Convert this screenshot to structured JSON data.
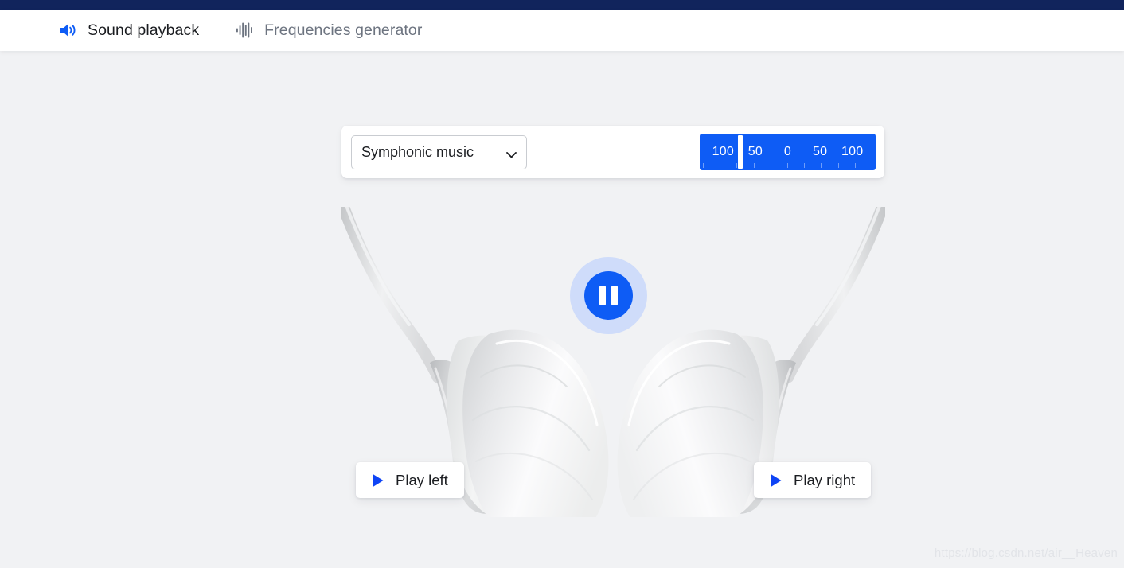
{
  "window": {
    "top_strip_color": "#11245c",
    "background_color": "#f1f2f4",
    "accent_color": "#0e5cf5"
  },
  "header": {
    "nav_items": [
      {
        "label": "Sound playback",
        "icon": "speaker-volume-icon",
        "active": true,
        "color": "#1b1d21"
      },
      {
        "label": "Frequencies generator",
        "icon": "audio-waveform-icon",
        "active": false,
        "color": "#6d7480"
      }
    ]
  },
  "controls": {
    "sound_select": {
      "label": "Sound selector",
      "selected": "Symphonic music",
      "options": [
        "Symphonic music"
      ],
      "chevron_icon": "chevron-down-icon"
    },
    "balance": {
      "label": "Left / right balance",
      "ticks_labels": [
        "100",
        "50",
        "0",
        "50",
        "100"
      ],
      "handle_position_percent": 23,
      "value": 100,
      "side": "left",
      "track_color": "#0e5cf5",
      "handle_color": "#ffffff",
      "tick_count": 11
    }
  },
  "player": {
    "pause_button": {
      "label": "Pause",
      "icon": "pause-icon",
      "state": "playing",
      "core_color": "#0e5cf5",
      "halo_color": "#cfdcfa"
    },
    "play_left_button": {
      "label": "Play left",
      "icon": "play-triangle-icon"
    },
    "play_right_button": {
      "label": "Play right",
      "icon": "play-triangle-icon"
    }
  },
  "illustration": {
    "name": "white-headphones-image",
    "alt": "White over-ear headphones split left and right"
  },
  "watermark": {
    "text": "https://blog.csdn.net/air__Heaven"
  }
}
